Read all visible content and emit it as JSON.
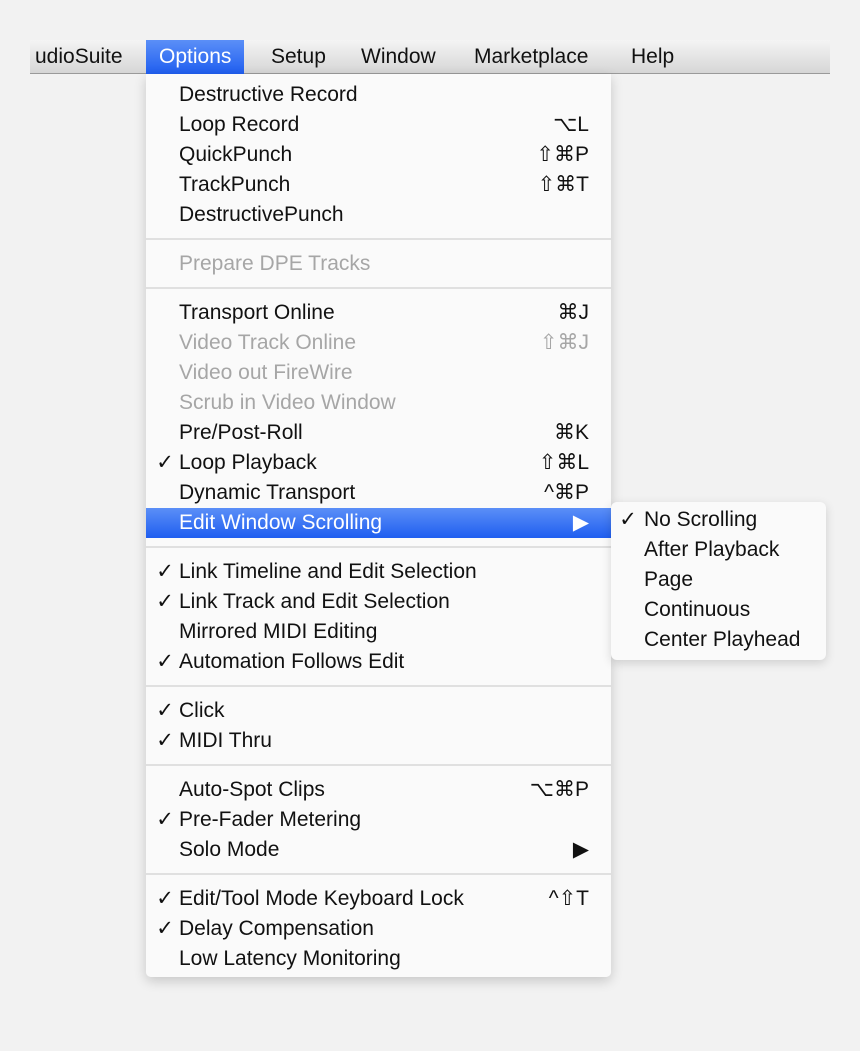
{
  "menubar": [
    {
      "label": "udioSuite",
      "active": false
    },
    {
      "label": "Options",
      "active": true
    },
    {
      "label": "Setup",
      "active": false
    },
    {
      "label": "Window",
      "active": false
    },
    {
      "label": "Marketplace",
      "active": false
    },
    {
      "label": "Help",
      "active": false
    }
  ],
  "options_menu": [
    {
      "label": "Destructive Record",
      "shortcut": "",
      "checked": false,
      "disabled": false
    },
    {
      "label": "Loop Record",
      "shortcut": "⌥L",
      "checked": false,
      "disabled": false
    },
    {
      "label": "QuickPunch",
      "shortcut": "⇧⌘P",
      "checked": false,
      "disabled": false
    },
    {
      "label": "TrackPunch",
      "shortcut": "⇧⌘T",
      "checked": false,
      "disabled": false
    },
    {
      "label": "DestructivePunch",
      "shortcut": "",
      "checked": false,
      "disabled": false
    },
    {
      "separator": true
    },
    {
      "label": "Prepare DPE Tracks",
      "shortcut": "",
      "checked": false,
      "disabled": true
    },
    {
      "separator": true
    },
    {
      "label": "Transport Online",
      "shortcut": "⌘J",
      "checked": false,
      "disabled": false
    },
    {
      "label": "Video Track Online",
      "shortcut": "⇧⌘J",
      "checked": false,
      "disabled": true
    },
    {
      "label": "Video out FireWire",
      "shortcut": "",
      "checked": false,
      "disabled": true
    },
    {
      "label": "Scrub in Video Window",
      "shortcut": "",
      "checked": false,
      "disabled": true
    },
    {
      "label": "Pre/Post-Roll",
      "shortcut": "⌘K",
      "checked": false,
      "disabled": false
    },
    {
      "label": "Loop Playback",
      "shortcut": "⇧⌘L",
      "checked": true,
      "disabled": false
    },
    {
      "label": "Dynamic Transport",
      "shortcut": "^⌘P",
      "checked": false,
      "disabled": false
    },
    {
      "label": "Edit Window Scrolling",
      "shortcut": "▶",
      "checked": false,
      "disabled": false,
      "highlighted": true,
      "submenu": true
    },
    {
      "separator": true
    },
    {
      "label": "Link Timeline and Edit Selection",
      "shortcut": "",
      "checked": true,
      "disabled": false
    },
    {
      "label": "Link Track and Edit Selection",
      "shortcut": "",
      "checked": true,
      "disabled": false
    },
    {
      "label": "Mirrored MIDI Editing",
      "shortcut": "",
      "checked": false,
      "disabled": false
    },
    {
      "label": "Automation Follows Edit",
      "shortcut": "",
      "checked": true,
      "disabled": false
    },
    {
      "separator": true
    },
    {
      "label": "Click",
      "shortcut": "",
      "checked": true,
      "disabled": false
    },
    {
      "label": "MIDI Thru",
      "shortcut": "",
      "checked": true,
      "disabled": false
    },
    {
      "separator": true
    },
    {
      "label": "Auto-Spot Clips",
      "shortcut": "⌥⌘P",
      "checked": false,
      "disabled": false
    },
    {
      "label": "Pre-Fader Metering",
      "shortcut": "",
      "checked": true,
      "disabled": false
    },
    {
      "label": "Solo Mode",
      "shortcut": "▶",
      "checked": false,
      "disabled": false,
      "submenu": true
    },
    {
      "separator": true
    },
    {
      "label": "Edit/Tool Mode Keyboard Lock",
      "shortcut": "^⇧T",
      "checked": true,
      "disabled": false
    },
    {
      "label": "Delay Compensation",
      "shortcut": "",
      "checked": true,
      "disabled": false
    },
    {
      "label": "Low Latency Monitoring",
      "shortcut": "",
      "checked": false,
      "disabled": false
    }
  ],
  "scrolling_submenu": [
    {
      "label": "No Scrolling",
      "checked": true
    },
    {
      "label": "After Playback",
      "checked": false
    },
    {
      "label": "Page",
      "checked": false
    },
    {
      "label": "Continuous",
      "checked": false
    },
    {
      "label": "Center Playhead",
      "checked": false
    }
  ],
  "check_glyph": "✓",
  "colors": {
    "highlight": "#2a66f2",
    "disabled_text": "#a6a6a6"
  }
}
